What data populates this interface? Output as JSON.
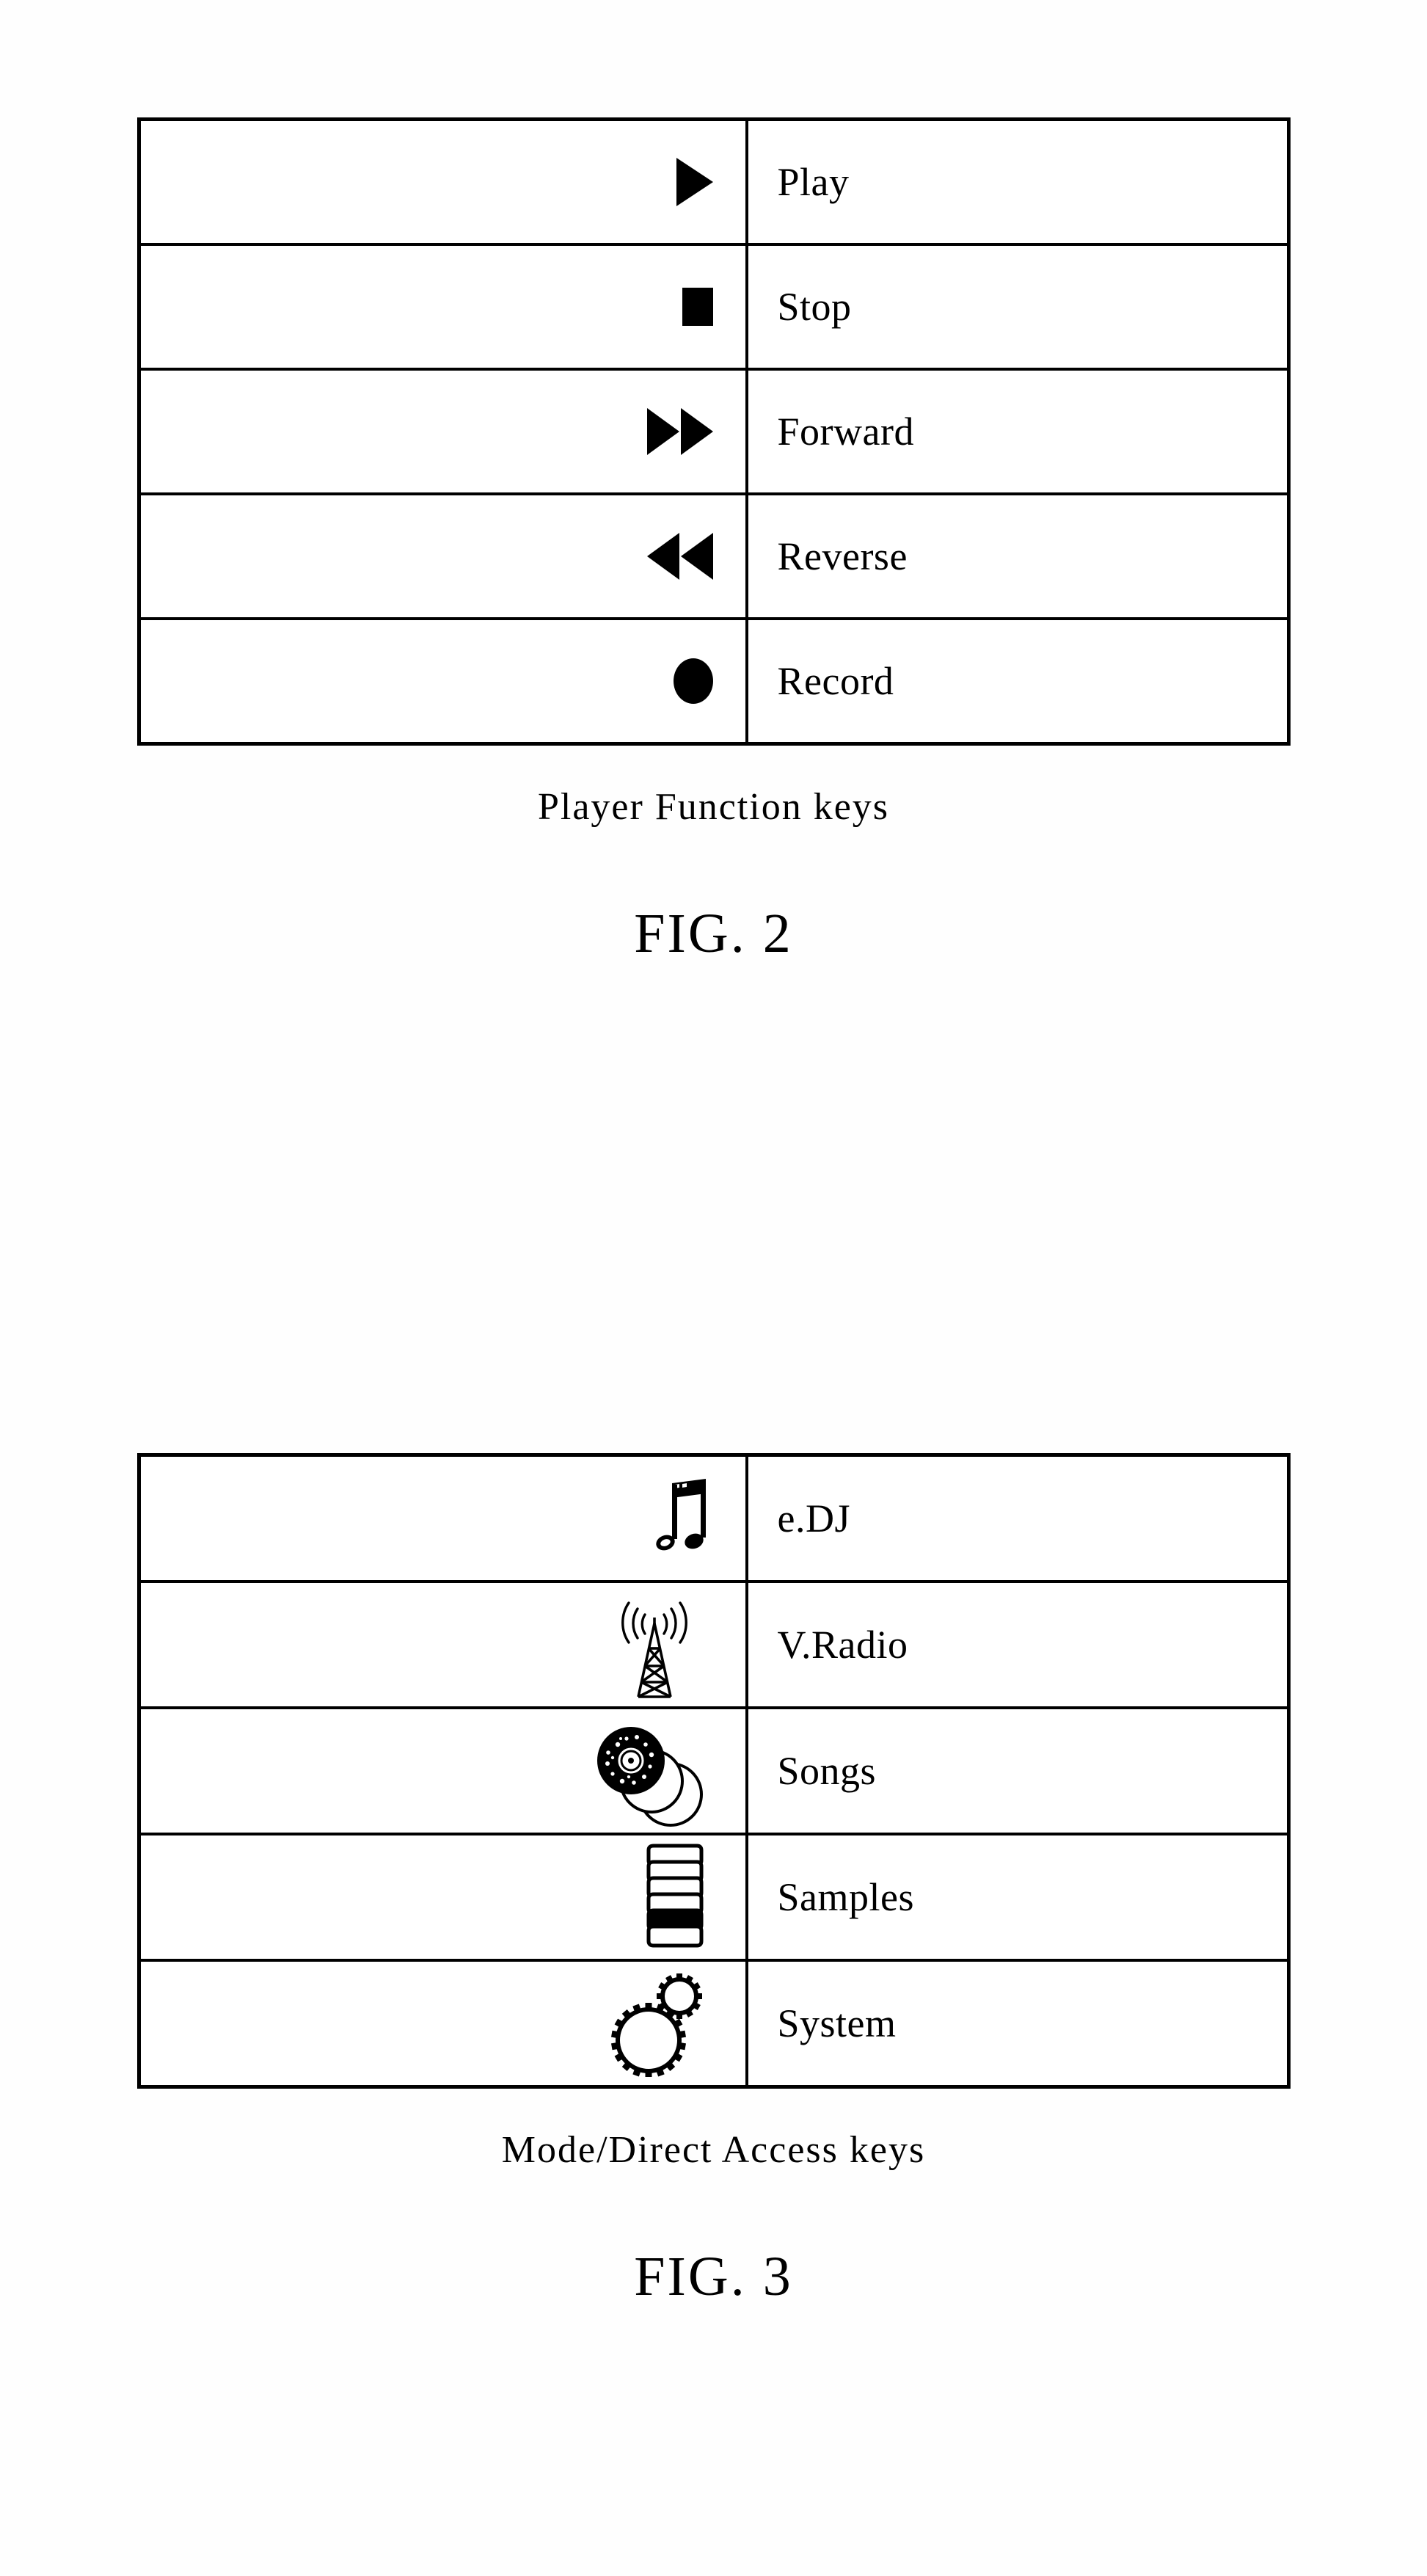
{
  "document": {
    "type": "patent-figure-page",
    "background_color": "#ffffff",
    "ink_color": "#000000"
  },
  "figures": [
    {
      "id": "fig2",
      "caption": "Player Function keys",
      "fig_label": "FIG. 2",
      "rows": [
        {
          "icon": "play-triangle-icon",
          "label": "Play"
        },
        {
          "icon": "stop-square-icon",
          "label": "Stop"
        },
        {
          "icon": "fast-forward-double-icon",
          "label": "Forward"
        },
        {
          "icon": "rewind-double-icon",
          "label": "Reverse"
        },
        {
          "icon": "record-circle-icon",
          "label": "Record"
        }
      ]
    },
    {
      "id": "fig3",
      "caption": "Mode/Direct Access keys",
      "fig_label": "FIG. 3",
      "rows": [
        {
          "icon": "music-note-icon",
          "label": "e.DJ"
        },
        {
          "icon": "radio-tower-icon",
          "label": "V.Radio"
        },
        {
          "icon": "compact-discs-icon",
          "label": "Songs"
        },
        {
          "icon": "stack-layers-icon",
          "label": "Samples"
        },
        {
          "icon": "gears-icon",
          "label": "System"
        }
      ]
    }
  ]
}
